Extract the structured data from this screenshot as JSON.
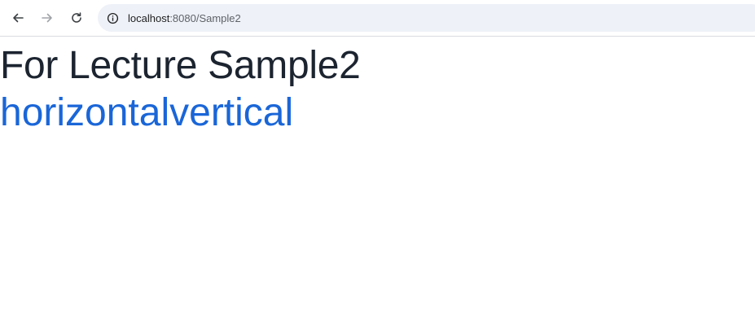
{
  "browser": {
    "url_host": "localhost",
    "url_rest": ":8080/Sample2",
    "icons": {
      "back": "arrow-left-icon",
      "forward": "arrow-right-icon",
      "reload": "reload-icon",
      "site_info": "info-icon"
    }
  },
  "page": {
    "heading": "For Lecture Sample2",
    "links": [
      "horizontal",
      "vertical"
    ],
    "link_color": "#1a66d8",
    "heading_color": "#1c2430"
  }
}
